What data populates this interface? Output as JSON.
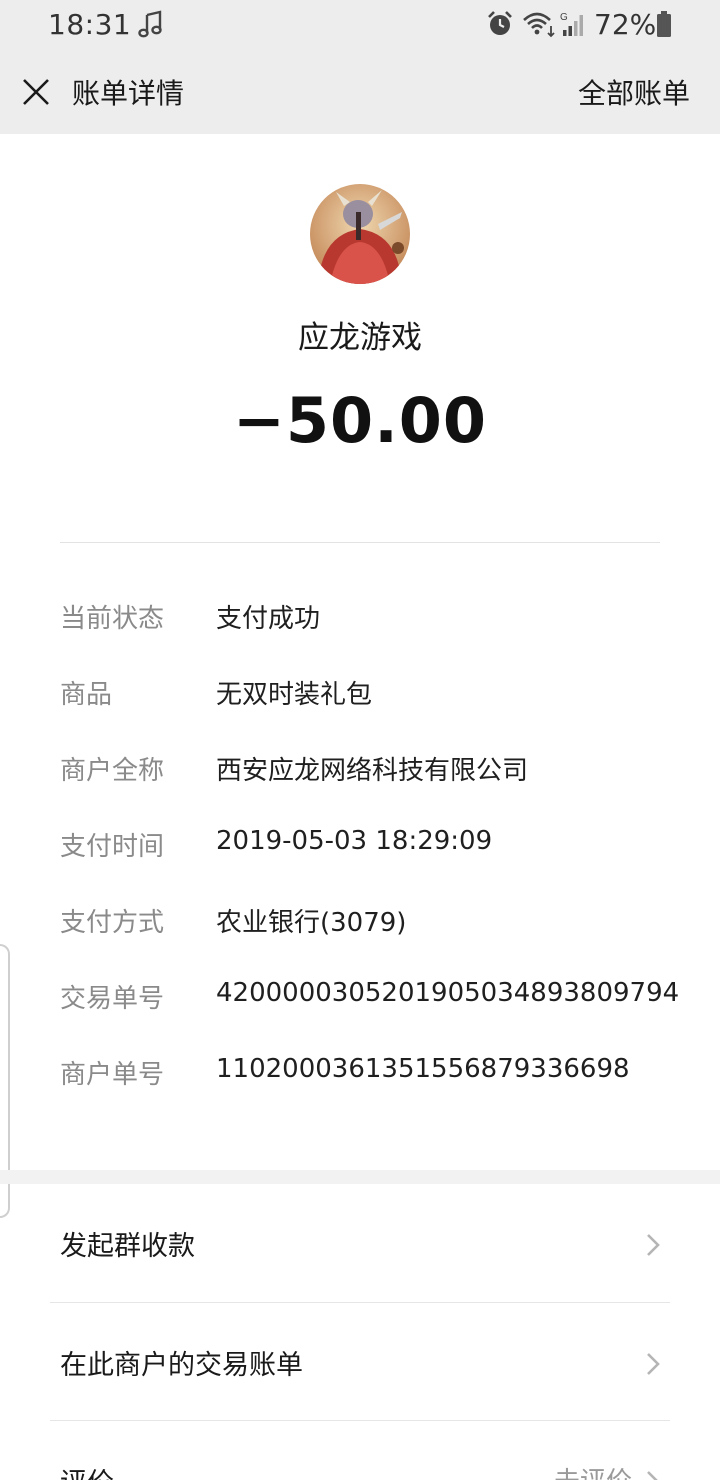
{
  "status_bar": {
    "time": "18:31",
    "battery": "72%",
    "icons": [
      "music-icon",
      "alarm-icon",
      "wifi-icon",
      "signal-icon",
      "battery-icon"
    ]
  },
  "nav": {
    "title": "账单详情",
    "right_action": "全部账单"
  },
  "summary": {
    "merchant": "应龙游戏",
    "amount": "−50.00"
  },
  "details": [
    {
      "label": "当前状态",
      "value": "支付成功"
    },
    {
      "label": "商品",
      "value": "无双时装礼包"
    },
    {
      "label": "商户全称",
      "value": "西安应龙网络科技有限公司"
    },
    {
      "label": "支付时间",
      "value": "2019-05-03 18:29:09"
    },
    {
      "label": "支付方式",
      "value": "农业银行(3079)"
    },
    {
      "label": "交易单号",
      "value": "4200000305201905034893809794"
    },
    {
      "label": "商户单号",
      "value": "1102000361351556879336698"
    }
  ],
  "menu": [
    {
      "label": "发起群收款",
      "sub": ""
    },
    {
      "label": "在此商户的交易账单",
      "sub": ""
    },
    {
      "label": "评价",
      "sub": "未评价"
    }
  ],
  "colors": {
    "header_bg": "#ededed",
    "label_gray": "#8a8a8a",
    "text_dark": "#1a1a1a"
  }
}
